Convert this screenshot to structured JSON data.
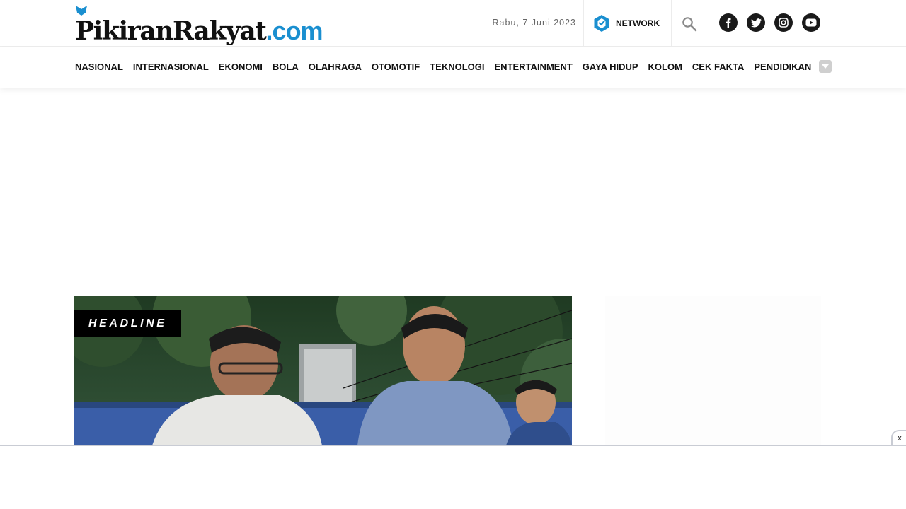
{
  "header": {
    "logo_text": "PikiranRakyat",
    "logo_suffix": "com",
    "date": "Rabu, 7 Juni 2023",
    "network_label": "NETWORK",
    "icons": {
      "network": "hexagon-logo-icon",
      "search": "search-icon",
      "socials": [
        "facebook-icon",
        "twitter-icon",
        "instagram-icon",
        "youtube-icon"
      ]
    }
  },
  "nav": {
    "items": [
      "NASIONAL",
      "INTERNASIONAL",
      "EKONOMI",
      "BOLA",
      "OLAHRAGA",
      "OTOMOTIF",
      "TEKNOLOGI",
      "ENTERTAINMENT",
      "GAYA HIDUP",
      "KOLOM",
      "CEK FAKTA",
      "PENDIDIKAN"
    ],
    "more_icon": "chevron-down-icon"
  },
  "headline": {
    "badge": "HEADLINE"
  },
  "sticky_ad": {
    "close_label": "x"
  },
  "colors": {
    "brand_blue": "#1a8fd0",
    "text": "#111111",
    "badge_bg": "#000000"
  }
}
